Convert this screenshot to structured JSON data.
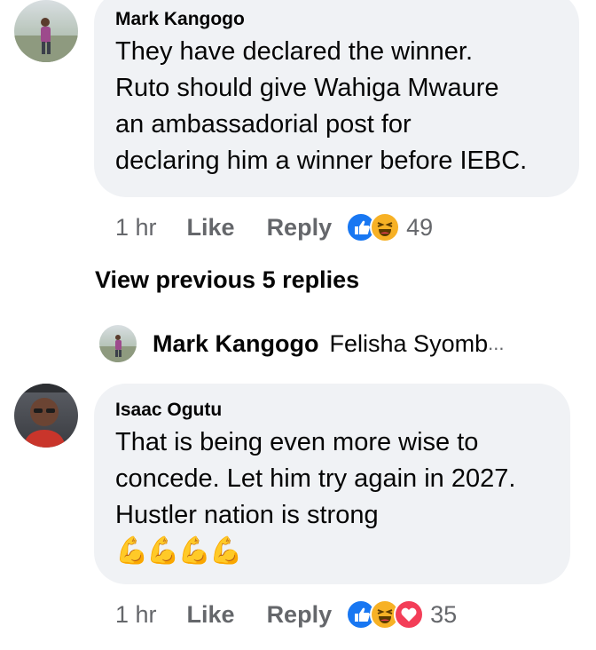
{
  "comments": [
    {
      "author": "Mark Kangogo",
      "lines": [
        "They have declared the winner.",
        "Ruto should give Wahiga Mwaure",
        "an ambassadorial post for",
        "declaring him a winner before IEBC."
      ],
      "time": "1 hr",
      "like_label": "Like",
      "reply_label": "Reply",
      "reactions": [
        "like-icon",
        "haha-icon"
      ],
      "reaction_count": "49"
    },
    {
      "author": "Isaac Ogutu",
      "lines": [
        "That is being even more wise to",
        "concede. Let him try again in 2027.",
        "Hustler nation is strong"
      ],
      "emoji": "💪💪💪💪",
      "time": "1 hr",
      "like_label": "Like",
      "reply_label": "Reply",
      "reactions": [
        "like-icon",
        "haha-icon",
        "love-icon"
      ],
      "reaction_count": "35"
    }
  ],
  "view_previous": "View previous 5 replies",
  "reply_preview": {
    "author": "Mark Kangogo",
    "snippet": "Felisha Syomb",
    "ellipsis": "..."
  },
  "colors": {
    "bubble": "#f0f2f5",
    "like": "#1877f2",
    "haha": "#f7b125",
    "love": "#f33e58",
    "meta": "#65676b"
  }
}
